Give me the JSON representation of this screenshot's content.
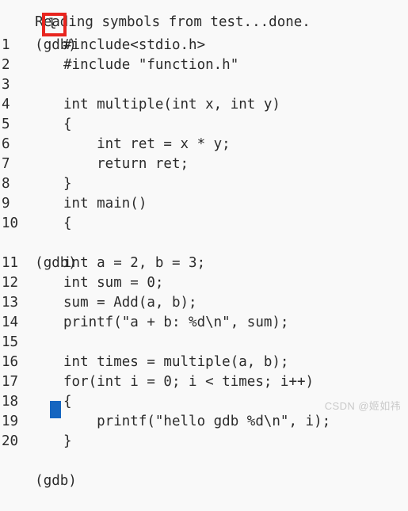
{
  "terminal": {
    "header_line": "Reading symbols from test...done.",
    "prompt": "(gdb)",
    "typed_command": "l",
    "prompt_mid": "(gdb)",
    "prompt_final": "(gdb)",
    "listing_part_one": [
      {
        "number": "1",
        "code": "        #include<stdio.h>"
      },
      {
        "number": "2",
        "code": "        #include \"function.h\""
      },
      {
        "number": "3",
        "code": ""
      },
      {
        "number": "4",
        "code": "        int multiple(int x, int y)"
      },
      {
        "number": "5",
        "code": "        {"
      },
      {
        "number": "6",
        "code": "            int ret = x * y;"
      },
      {
        "number": "7",
        "code": "            return ret;"
      },
      {
        "number": "8",
        "code": "        }"
      },
      {
        "number": "9",
        "code": "        int main()"
      },
      {
        "number": "10",
        "code": "        {"
      }
    ],
    "listing_part_two": [
      {
        "number": "11",
        "code": "        int a = 2, b = 3;"
      },
      {
        "number": "12",
        "code": "        int sum = 0;"
      },
      {
        "number": "13",
        "code": "        sum = Add(a, b);"
      },
      {
        "number": "14",
        "code": "        printf(\"a + b: %d\\n\", sum);"
      },
      {
        "number": "15",
        "code": ""
      },
      {
        "number": "16",
        "code": "        int times = multiple(a, b);"
      },
      {
        "number": "17",
        "code": "        for(int i = 0; i < times; i++)"
      },
      {
        "number": "18",
        "code": "        {"
      },
      {
        "number": "19",
        "code": "            printf(\"hello gdb %d\\n\", i);"
      },
      {
        "number": "20",
        "code": "        }"
      }
    ]
  },
  "annotation": {
    "highlight_color": "#e8251f",
    "cursor_color": "#1565c0"
  },
  "watermark": {
    "text": "CSDN @姬如祎"
  }
}
